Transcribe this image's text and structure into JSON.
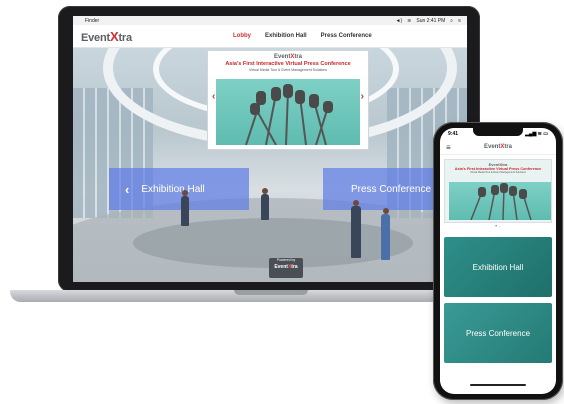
{
  "mac_bar": {
    "app": "Finder",
    "clock": "Sun 2:41 PM"
  },
  "brand": {
    "name_before": "Event",
    "name_x": "X",
    "name_after": "tra",
    "accent_color": "#d32f2f"
  },
  "nav": {
    "items": [
      {
        "label": "Lobby",
        "active": true
      },
      {
        "label": "Exhibition Hall",
        "active": false
      },
      {
        "label": "Press Conference",
        "active": false
      }
    ]
  },
  "billboard": {
    "title": "Asia's First Interactive Virtual Press Conference",
    "subtitle": "Virtual Media Tour & Event Management Solutions"
  },
  "lobby": {
    "left_panel": "Exhibition Hall",
    "right_panel": "Press Conference",
    "powered_by": "Powered by"
  },
  "phone": {
    "time": "9:41",
    "banner_title": "Asia's First Interactive Virtual Press Conference",
    "cards": [
      "Exhibition Hall",
      "Press Conference"
    ]
  },
  "icons": {
    "apple": "apple-icon",
    "menu": "hamburger-menu-icon",
    "left": "chevron-left-icon",
    "right": "chevron-right-icon"
  }
}
